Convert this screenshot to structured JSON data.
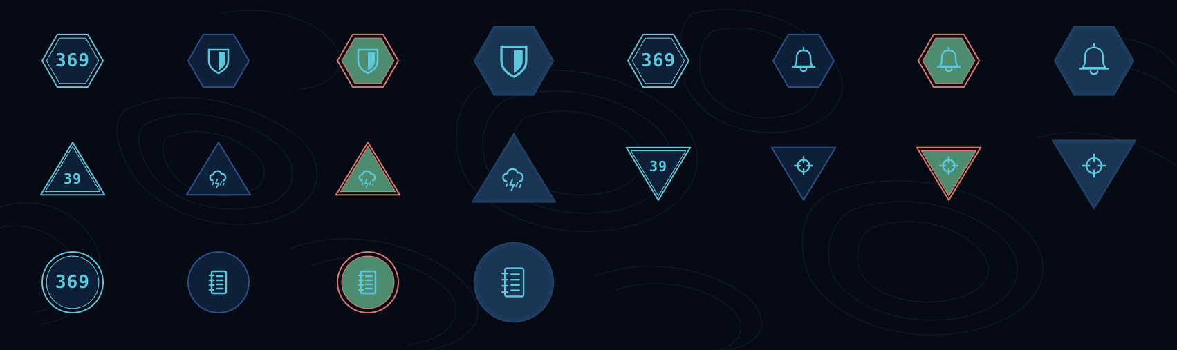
{
  "colors": {
    "background": "#050a14",
    "contour": "#101c2e",
    "teal": "#5cc8dc",
    "navy_stroke": "#2d4f86",
    "salmon": "#e0786a",
    "green_fill": "#4e8c70",
    "dark_fill": "#0e2038",
    "glow_fill": "#1d3a5c"
  },
  "rows": [
    {
      "shape": "hexagon",
      "badges": [
        {
          "style": "teal-outline",
          "content": "number",
          "text": "369"
        },
        {
          "style": "navy-outline",
          "content": "icon",
          "icon": "shield-icon"
        },
        {
          "style": "salmon-green",
          "content": "icon",
          "icon": "shield-icon"
        },
        {
          "style": "glow-large",
          "content": "icon",
          "icon": "shield-icon"
        },
        {
          "style": "teal-outline",
          "content": "number",
          "text": "369"
        },
        {
          "style": "navy-outline",
          "content": "icon",
          "icon": "bell-icon"
        },
        {
          "style": "salmon-green",
          "content": "icon",
          "icon": "bell-icon"
        },
        {
          "style": "glow-large",
          "content": "icon",
          "icon": "bell-icon"
        }
      ]
    },
    {
      "shape": "triangle",
      "badges": [
        {
          "style": "teal-outline",
          "content": "number",
          "text": "39",
          "orientation": "up"
        },
        {
          "style": "navy-outline",
          "content": "icon",
          "icon": "thunderstorm-cloud-icon",
          "orientation": "up"
        },
        {
          "style": "salmon-green",
          "content": "icon",
          "icon": "thunderstorm-cloud-icon",
          "orientation": "up"
        },
        {
          "style": "glow-large",
          "content": "icon",
          "icon": "thunderstorm-cloud-icon",
          "orientation": "up"
        },
        {
          "style": "teal-outline",
          "content": "number",
          "text": "39",
          "orientation": "down"
        },
        {
          "style": "navy-outline",
          "content": "icon",
          "icon": "crosshair-icon",
          "orientation": "down"
        },
        {
          "style": "salmon-green",
          "content": "icon",
          "icon": "crosshair-icon",
          "orientation": "down"
        },
        {
          "style": "glow-large",
          "content": "icon",
          "icon": "crosshair-icon",
          "orientation": "down"
        }
      ]
    },
    {
      "shape": "circle",
      "badges": [
        {
          "style": "teal-outline",
          "content": "number",
          "text": "369"
        },
        {
          "style": "navy-outline",
          "content": "icon",
          "icon": "notebook-icon"
        },
        {
          "style": "salmon-green",
          "content": "icon",
          "icon": "notebook-icon"
        },
        {
          "style": "glow-large",
          "content": "icon",
          "icon": "notebook-icon"
        }
      ]
    }
  ]
}
